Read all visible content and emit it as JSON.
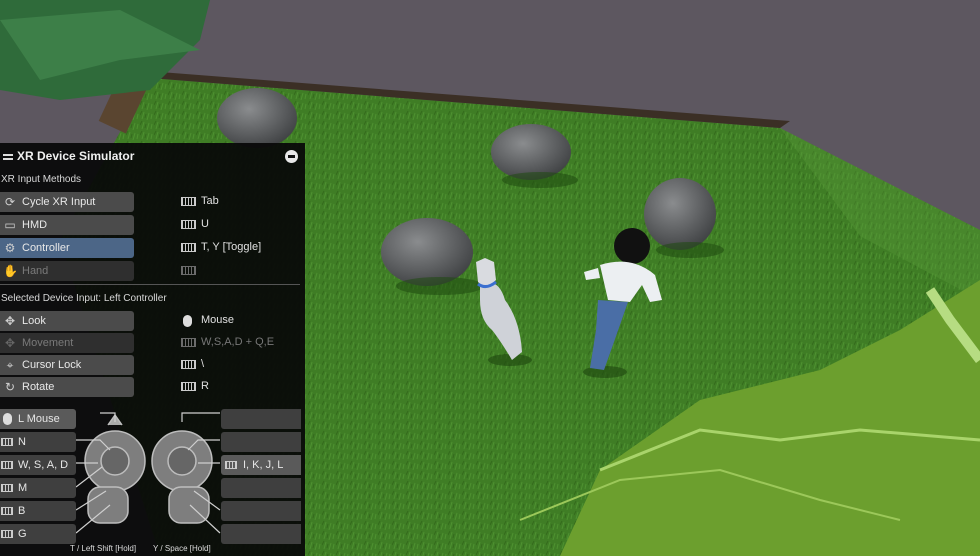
{
  "panel": {
    "title": "XR Device Simulator",
    "sections": {
      "input_methods": "XR Input Methods",
      "selected_device": "Selected Device Input:  Left Controller"
    },
    "input_methods": [
      {
        "label": "Cycle XR Input",
        "key": "Tab",
        "state": "normal"
      },
      {
        "label": "HMD",
        "key": "U",
        "state": "normal"
      },
      {
        "label": "Controller",
        "key": "T, Y [Toggle]",
        "state": "selected"
      },
      {
        "label": "Hand",
        "key": "",
        "state": "disabled"
      }
    ],
    "device_inputs": [
      {
        "label": "Look",
        "key": "Mouse",
        "state": "normal"
      },
      {
        "label": "Movement",
        "key": "W,S,A,D + Q,E",
        "state": "disabled"
      },
      {
        "label": "Cursor Lock",
        "key": "\\",
        "state": "normal"
      },
      {
        "label": "Rotate",
        "key": "R",
        "state": "normal"
      }
    ],
    "left_controller_bindings": [
      "L Mouse",
      "N",
      "W, S, A, D",
      "M",
      "B",
      "G"
    ],
    "right_controller_bindings": [
      "",
      "",
      "I, K, J, L",
      "",
      "",
      ""
    ],
    "footer": {
      "left": "T / Left Shift [Hold]",
      "right": "Y / Space [Hold]"
    }
  },
  "colors": {
    "panel_bg": "#080808",
    "button": "#4b4b4b",
    "button_selected": "#4c6687",
    "button_disabled": "#2f2f2f",
    "grass": "#3f7a24",
    "sky": "#5d5760"
  }
}
